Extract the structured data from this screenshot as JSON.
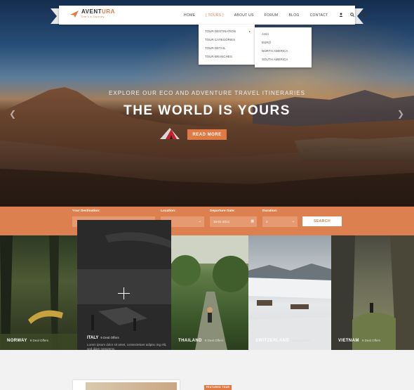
{
  "brand": {
    "name_main": "AVENT",
    "name_accent": "URA",
    "tagline": "Life's a Journey",
    "accent_color": "#e07a45"
  },
  "nav": {
    "items": [
      {
        "label": "HOME"
      },
      {
        "label": "[ TOURS ]",
        "active": true
      },
      {
        "label": "ABOUT US"
      },
      {
        "label": "FORUM"
      },
      {
        "label": "BLOG"
      },
      {
        "label": "CONTACT"
      }
    ],
    "icons": [
      "user-icon",
      "search-icon",
      "cart-icon"
    ]
  },
  "tours_menu": {
    "items": [
      "TOUR DESTINATION",
      "TOUR CATEGORIES",
      "TOUR DETAIL",
      "TOUR BRANCHES"
    ],
    "submenu_arrow": "▸"
  },
  "destination_menu": {
    "items": [
      "ASIA",
      "EURO",
      "NORTH AMERICA",
      "SOUTH AMERICA"
    ]
  },
  "hero": {
    "subtitle": "EXPLORE OUR ECO AND ADVENTURE TRAVEL ITINERARIES",
    "title": "THE WORLD IS YOURS",
    "button": "READ MORE",
    "prev": "❮",
    "next": "❯"
  },
  "search": {
    "destination_label": "Your Destination:",
    "destination_value": "",
    "location_label": "Location:",
    "location_value": "",
    "date_label": "Departure Date:",
    "date_value": "16-01-2014",
    "duration_label": "Duration:",
    "duration_value": "2",
    "button": "SEARCH",
    "bar_color": "#dd8050"
  },
  "tiles": [
    {
      "name": "NORWAY",
      "offers": "9 Deal Offers"
    },
    {
      "name": "ITALY",
      "offers": "9 Deal Offers",
      "description": "Lorem ipsum dolor sit amet, consectetuer adipisc ing elit, sed diam nonummy."
    },
    {
      "name": "THAILAND",
      "offers": "9 Deal Offers"
    },
    {
      "name": "SWITZERLAND",
      "offers": "9 Deal Offers"
    },
    {
      "name": "VIETNAM",
      "offers": "9 Deal Offers"
    }
  ],
  "bottom": {
    "featured_badge": "FEATURED TOUR"
  }
}
